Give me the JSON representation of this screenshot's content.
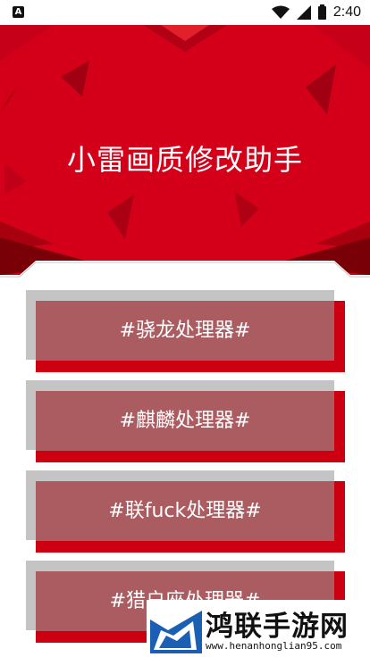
{
  "status_bar": {
    "app_icon_letter": "A",
    "time": "2:40"
  },
  "header": {
    "title": "小雷画质修改助手"
  },
  "processors": [
    {
      "label": "#骁龙处理器#"
    },
    {
      "label": "#麒麟处理器#"
    },
    {
      "label": "#联fuck处理器#"
    },
    {
      "label": "#猎户座处理器#"
    }
  ],
  "watermark": {
    "name": "鸿联手游网",
    "url": "www.henanhonglian95.com"
  },
  "colors": {
    "header_red": "#d4001a",
    "card_face": "#ab5c61",
    "card_shadow_red": "#cc0010",
    "card_shadow_gray": "#c4c4c4"
  }
}
